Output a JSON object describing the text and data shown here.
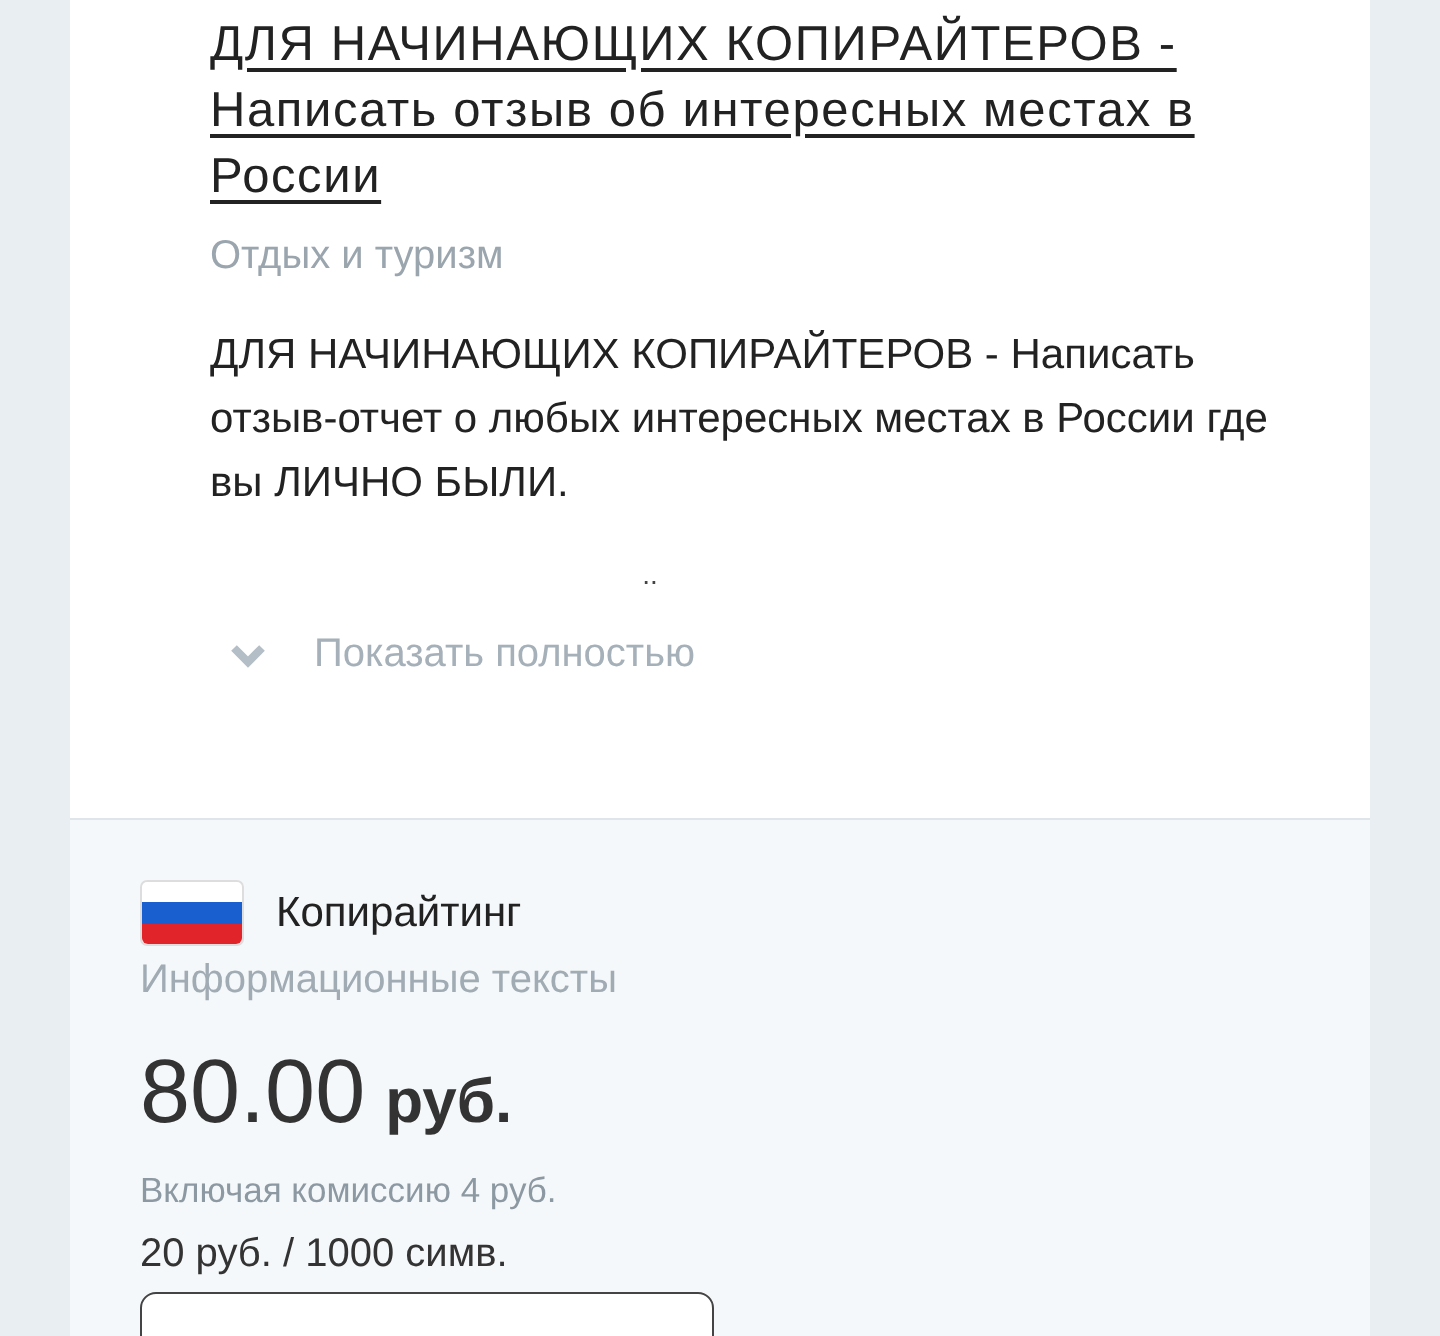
{
  "task": {
    "title": "ДЛЯ НАЧИНАЮЩИХ КОПИРАЙТЕРОВ - Написать отзыв об интересных местах в России",
    "category": "Отдых и туризм",
    "description": "ДЛЯ НАЧИНАЮЩИХ КОПИРАЙТЕРОВ - Написать отзыв-отчет о любых интересных местах в России где вы ЛИЧНО БЫЛИ.",
    "ellipsis": "..",
    "expand": {
      "label": "Показать полностью",
      "expanded": false
    }
  },
  "offer": {
    "service": "Копирайтинг",
    "subtype": "Информационные тексты",
    "price": "80.00",
    "currency": "руб.",
    "commission": "Включая комиссию 4 руб.",
    "rate": "20 руб. / 1000 симв."
  }
}
